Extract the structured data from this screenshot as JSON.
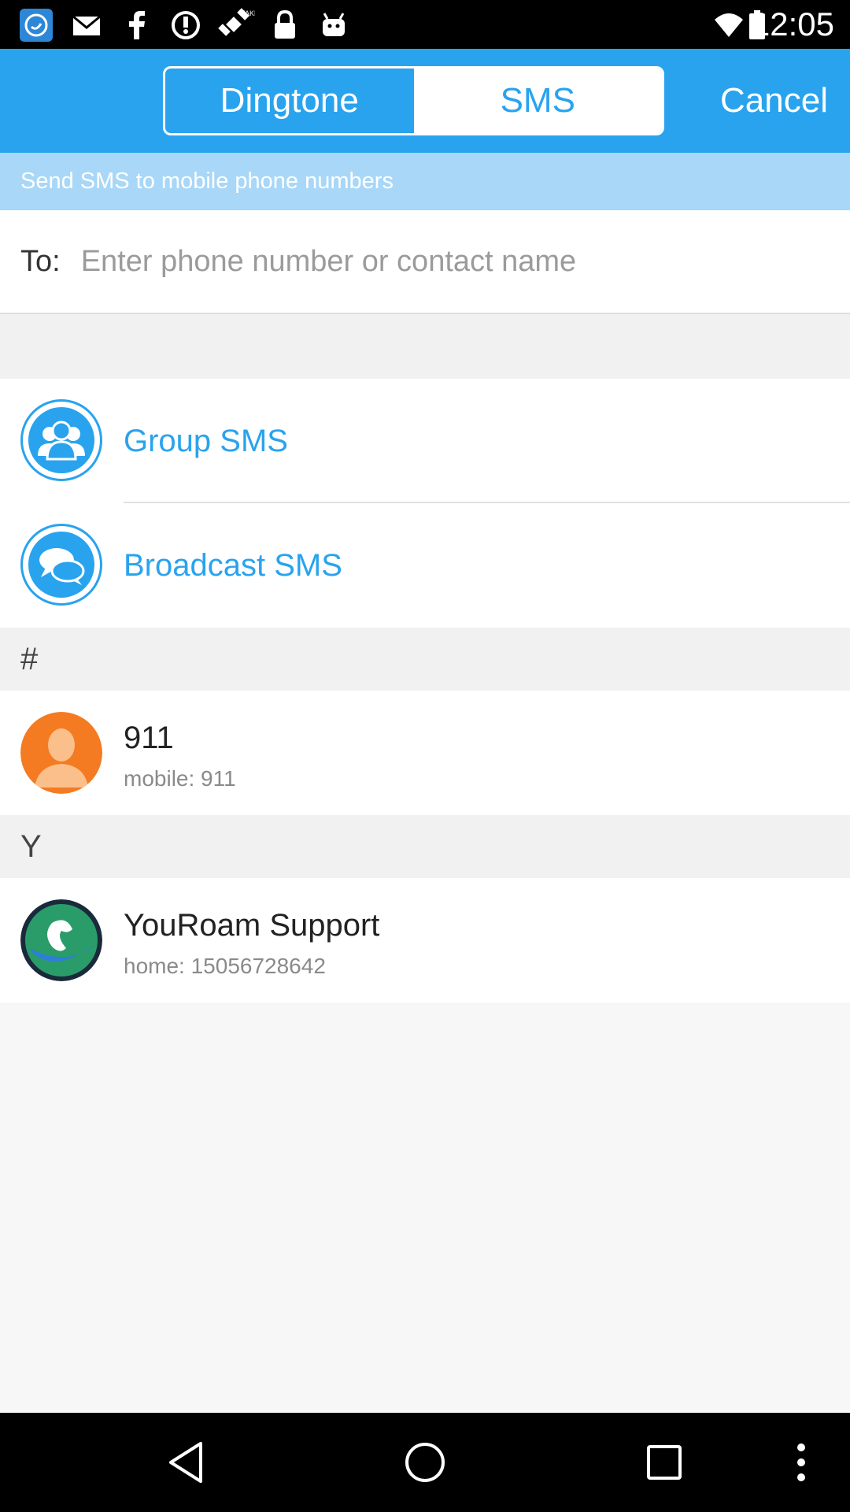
{
  "status_bar": {
    "time": "12:05",
    "icons": [
      "app-notification-icon",
      "mail-icon",
      "facebook-icon",
      "sync-icon",
      "fake-gps-icon",
      "lock-icon",
      "android-icon"
    ]
  },
  "header": {
    "tabs": [
      {
        "label": "Dingtone",
        "active": false
      },
      {
        "label": "SMS",
        "active": true
      }
    ],
    "cancel_label": "Cancel",
    "accent_color": "#29a3ee"
  },
  "banner": {
    "text": "Send SMS to mobile phone numbers"
  },
  "to_field": {
    "label": "To:",
    "placeholder": "Enter phone number or contact name",
    "value": ""
  },
  "options": [
    {
      "label": "Group SMS",
      "icon": "group-icon"
    },
    {
      "label": "Broadcast SMS",
      "icon": "chat-bubbles-icon"
    }
  ],
  "sections": [
    {
      "header": "#",
      "contacts": [
        {
          "name": "911",
          "detail": "mobile: 911",
          "avatar": "person-avatar-icon"
        }
      ]
    },
    {
      "header": "Y",
      "contacts": [
        {
          "name": "YouRoam Support",
          "detail": "home: 15056728642",
          "avatar": "youroam-logo-icon"
        }
      ]
    }
  ],
  "nav_bar": {
    "buttons": [
      "back-icon",
      "home-icon",
      "recents-icon",
      "overflow-menu-icon"
    ]
  }
}
